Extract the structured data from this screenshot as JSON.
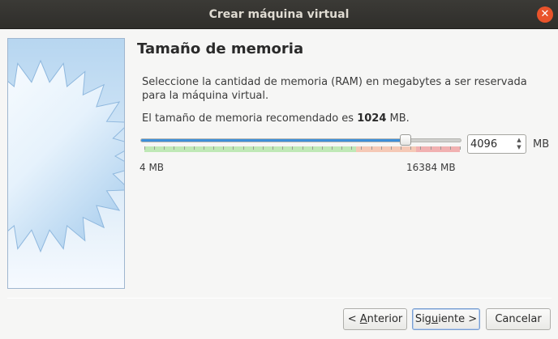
{
  "window": {
    "title": "Crear máquina virtual",
    "close_glyph": "✕"
  },
  "page": {
    "heading": "Tamaño de memoria",
    "description": "Seleccione la cantidad de memoria (RAM) en megabytes a ser reservada para la máquina virtual.",
    "recommended_prefix": "El tamaño de memoria recomendado es ",
    "recommended_value": "1024",
    "recommended_suffix": " MB."
  },
  "memory": {
    "value": "4096",
    "unit": "MB",
    "min_label": "4 MB",
    "max_label": "16384 MB",
    "min_mb": 4,
    "max_mb": 16384,
    "current_mb": 4096,
    "colors": {
      "accent": "#3d8fd9",
      "safe": "#bfe8b6",
      "warning": "#f5c9b6",
      "danger": "#f1b1b1"
    }
  },
  "buttons": {
    "back": {
      "prefix": "< ",
      "mnemonic": "A",
      "rest": "nterior"
    },
    "next": {
      "prefix": "Sig",
      "mnemonic": "u",
      "rest": "iente >"
    },
    "cancel": "Cancelar"
  },
  "icons": {
    "close": "close-icon",
    "side": "virtualbox-wizard-image",
    "spin_up": "chevron-up-icon",
    "spin_down": "chevron-down-icon"
  }
}
